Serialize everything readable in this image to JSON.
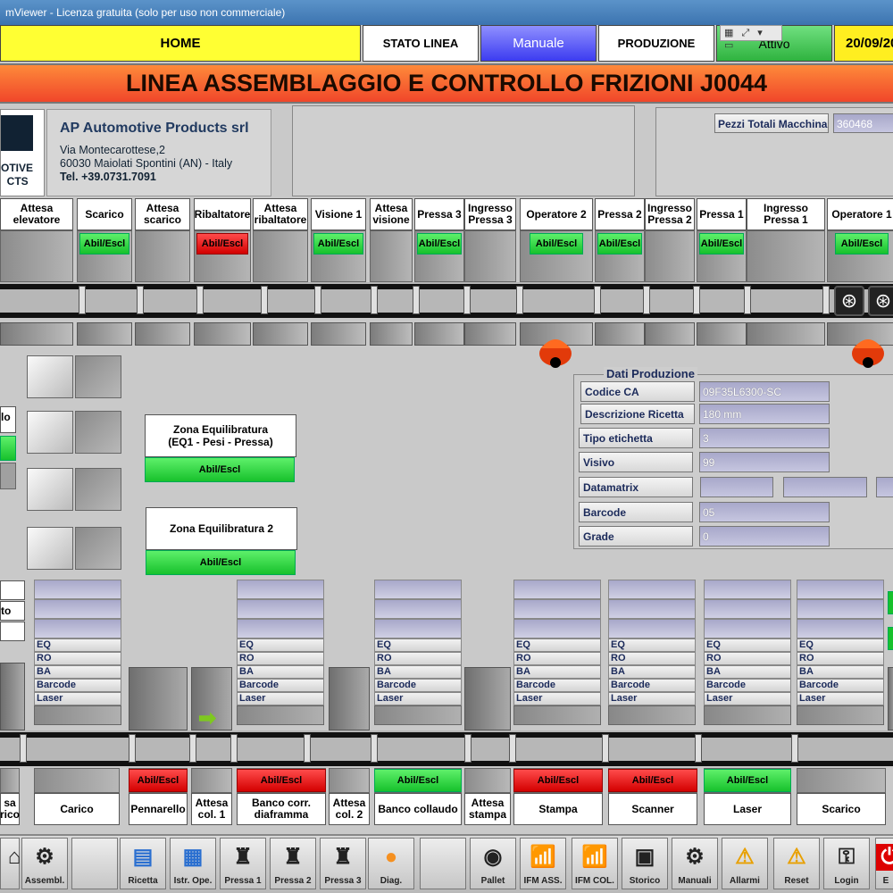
{
  "window": {
    "title": "mViewer - Licenza gratuita (solo per uso non commerciale)",
    "controls": "▦ ⤢ ▾ ▭"
  },
  "nav": {
    "home": "HOME",
    "stato": "STATO LINEA",
    "manuale": "Manuale",
    "produzione": "PRODUZIONE",
    "attivo": "Attivo",
    "date": "20/09/20"
  },
  "banner": "LINEA ASSEMBLAGGIO E CONTROLLO FRIZIONI J0044",
  "logo": {
    "line1": "OTIVE",
    "line2": "CTS"
  },
  "company": {
    "name": "AP Automotive Products srl",
    "addr1": "Via Montecarottese,2",
    "addr2": "60030 Maiolati Spontini (AN) - Italy",
    "tel": "Tel. +39.0731.7091"
  },
  "pezzi": {
    "label": "Pezzi Totali Macchina",
    "value": "360468"
  },
  "top_stations": [
    {
      "label": "Attesa elevatore",
      "abil": ""
    },
    {
      "label": "Scarico",
      "abil": "green"
    },
    {
      "label": "Attesa scarico",
      "abil": ""
    },
    {
      "label": "Ribaltatore",
      "abil": "red"
    },
    {
      "label": "Attesa ribaltatore",
      "abil": ""
    },
    {
      "label": "Visione 1",
      "abil": "green"
    },
    {
      "label": "Attesa visione",
      "abil": ""
    },
    {
      "label": "Pressa 3",
      "abil": "green"
    },
    {
      "label": "Ingresso Pressa 3",
      "abil": ""
    },
    {
      "label": "Operatore 2",
      "abil": "green"
    },
    {
      "label": "Pressa 2",
      "abil": "green"
    },
    {
      "label": "Ingresso Pressa 2",
      "abil": ""
    },
    {
      "label": "Pressa 1",
      "abil": "green"
    },
    {
      "label": "Ingresso Pressa 1",
      "abil": ""
    },
    {
      "label": "Operatore 1",
      "abil": "green"
    }
  ],
  "abil_label": "Abil/Escl",
  "left_fragments": {
    "frag1": "lo",
    "frag2": "to"
  },
  "zones": [
    {
      "label": "Zona Equilibratura\n(EQ1 - Pesi - Pressa)",
      "abil": "Abil/Escl"
    },
    {
      "label": "Zona Equilibratura 2",
      "abil": "Abil/Escl"
    }
  ],
  "dati": {
    "title": "Dati Produzione",
    "rows": [
      {
        "label": "Codice CA",
        "value": "09F35L6300-SC"
      },
      {
        "label": "Descrizione Ricetta",
        "value": "180 mm"
      },
      {
        "label": "Tipo etichetta",
        "value": "3"
      },
      {
        "label": "Visivo",
        "value": "99"
      },
      {
        "label": "Datamatrix",
        "value": ""
      },
      {
        "label": "Barcode",
        "value": "05"
      },
      {
        "label": "Grade",
        "value": "0"
      }
    ]
  },
  "lot_rows": [
    "EQ",
    "RO",
    "BA",
    "Barcode",
    "Laser"
  ],
  "bottom_stations": [
    {
      "label": "sa\nrico",
      "abil": ""
    },
    {
      "label": "Carico",
      "abil": ""
    },
    {
      "label": "Pennarello",
      "abil": "red"
    },
    {
      "label": "Attesa col. 1",
      "abil": ""
    },
    {
      "label": "Banco corr. diaframma",
      "abil": "red"
    },
    {
      "label": "Attesa col. 2",
      "abil": ""
    },
    {
      "label": "Banco collaudo",
      "abil": "green"
    },
    {
      "label": "Attesa stampa",
      "abil": ""
    },
    {
      "label": "Stampa",
      "abil": "red"
    },
    {
      "label": "Scanner",
      "abil": "red"
    },
    {
      "label": "Laser",
      "abil": "green"
    },
    {
      "label": "Scarico",
      "abil": ""
    }
  ],
  "toolbar": [
    {
      "label": "",
      "icon": "home-icon",
      "glyph": "⌂"
    },
    {
      "label": "Assembl.",
      "icon": "assembly-icon",
      "glyph": "⚙"
    },
    {
      "label": "",
      "icon": "blank",
      "glyph": ""
    },
    {
      "label": "Ricetta",
      "icon": "recipe-icon",
      "glyph": "▤"
    },
    {
      "label": "Istr. Ope.",
      "icon": "instructions-icon",
      "glyph": "▦"
    },
    {
      "label": "Pressa 1",
      "icon": "press-icon",
      "glyph": "♜"
    },
    {
      "label": "Pressa 2",
      "icon": "press-icon",
      "glyph": "♜"
    },
    {
      "label": "Pressa 3",
      "icon": "press-icon",
      "glyph": "♜"
    },
    {
      "label": "Diag.",
      "icon": "diagnostic-icon",
      "glyph": "●"
    },
    {
      "label": "",
      "icon": "blank",
      "glyph": ""
    },
    {
      "label": "Pallet",
      "icon": "pallet-icon",
      "glyph": "◉"
    },
    {
      "label": "IFM ASS.",
      "icon": "antenna-icon",
      "glyph": "📶"
    },
    {
      "label": "IFM COL.",
      "icon": "antenna-icon",
      "glyph": "📶"
    },
    {
      "label": "Storico",
      "icon": "history-icon",
      "glyph": "▣"
    },
    {
      "label": "Manuali",
      "icon": "manuals-icon",
      "glyph": "⚙"
    },
    {
      "label": "Allarmi",
      "icon": "alarm-icon",
      "glyph": "⚠"
    },
    {
      "label": "Reset",
      "icon": "reset-icon",
      "glyph": "⚠"
    },
    {
      "label": "Login",
      "icon": "key-icon",
      "glyph": "⚿"
    },
    {
      "label": "E",
      "icon": "exit-icon",
      "glyph": "⏻"
    }
  ],
  "colors": {
    "banner": "#f0462a",
    "abil_green": "#17c12c",
    "abil_red": "#d30000",
    "manuale": "#5b5bff",
    "attivo": "#31c441",
    "date_bg": "#ffee20"
  }
}
